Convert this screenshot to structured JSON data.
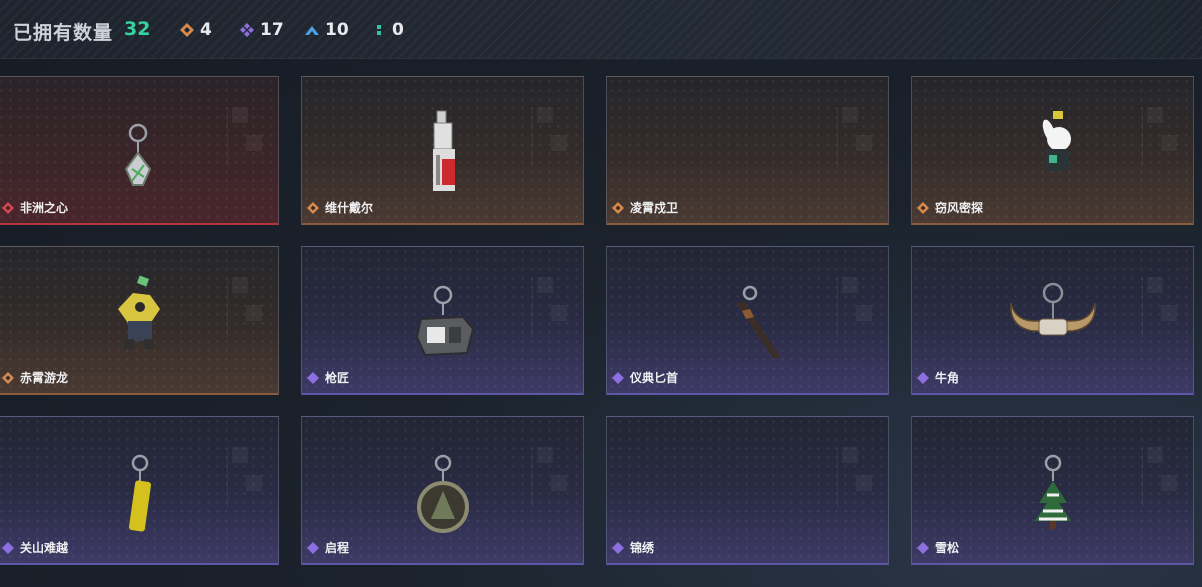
{
  "header": {
    "owned_label": "已拥有数量",
    "owned_count": "32",
    "stats": [
      {
        "icon": "orange-diamond-icon",
        "value": "4",
        "color": "#d88a4c"
      },
      {
        "icon": "purple-diamond-icon",
        "value": "17",
        "color": "#8d6fe0"
      },
      {
        "icon": "blue-chevron-icon",
        "value": "10",
        "color": "#4aa3e8"
      },
      {
        "icon": "teal-dots-icon",
        "value": "0",
        "color": "#30c6a2"
      }
    ]
  },
  "items": [
    {
      "name": "非洲之心",
      "rarity": "red",
      "icon": "gem-keychain-icon"
    },
    {
      "name": "维什戴尔",
      "rarity": "orange",
      "icon": "device-keychain-icon"
    },
    {
      "name": "凌霄戍卫",
      "rarity": "orange",
      "icon": ""
    },
    {
      "name": "窃风密探",
      "rarity": "orange",
      "icon": "rabbit-keychain-icon"
    },
    {
      "name": "赤霄游龙",
      "rarity": "orange",
      "icon": "dragon-keychain-icon"
    },
    {
      "name": "枪匠",
      "rarity": "purple",
      "icon": "case-keychain-icon"
    },
    {
      "name": "仪典匕首",
      "rarity": "purple",
      "icon": "dagger-keychain-icon"
    },
    {
      "name": "牛角",
      "rarity": "purple",
      "icon": "horns-keychain-icon"
    },
    {
      "name": "关山难越",
      "rarity": "purple",
      "icon": "cylinder-keychain-icon"
    },
    {
      "name": "启程",
      "rarity": "purple",
      "icon": "medal-keychain-icon"
    },
    {
      "name": "锦绣",
      "rarity": "purple",
      "icon": ""
    },
    {
      "name": "雪松",
      "rarity": "purple",
      "icon": "pine-keychain-icon"
    }
  ],
  "colors": {
    "red": "#d6454f",
    "orange": "#d88a4c",
    "purple": "#8d6fe0"
  }
}
